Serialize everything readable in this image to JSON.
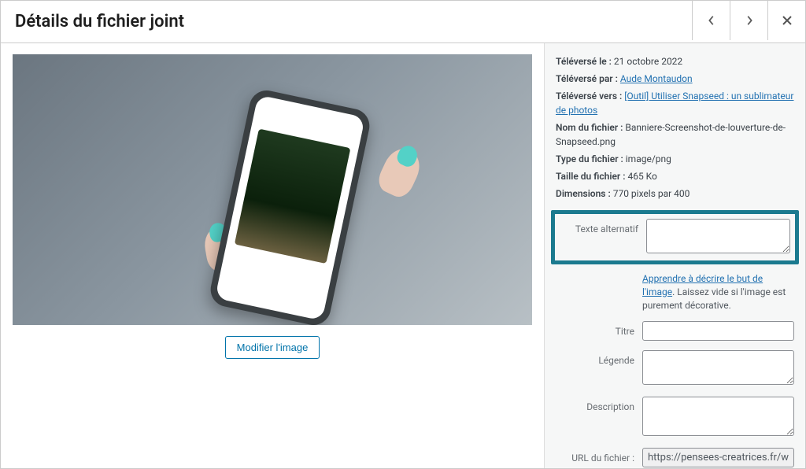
{
  "header": {
    "title": "Détails du fichier joint"
  },
  "preview": {
    "edit_button": "Modifier l'image"
  },
  "meta": {
    "uploaded_on_label": "Téléversé le :",
    "uploaded_on_value": "21 octobre 2022",
    "uploaded_by_label": "Téléversé par :",
    "uploaded_by_value": "Aude Montaudon",
    "uploaded_to_label": "Téléversé vers :",
    "uploaded_to_value": "[Outil] Utiliser Snapseed : un sublimateur de photos",
    "filename_label": "Nom du fichier :",
    "filename_value": "Banniere-Screenshot-de-louverture-de-Snapseed.png",
    "filetype_label": "Type du fichier :",
    "filetype_value": "image/png",
    "filesize_label": "Taille du fichier :",
    "filesize_value": "465 Ko",
    "dimensions_label": "Dimensions :",
    "dimensions_value": "770 pixels par 400"
  },
  "fields": {
    "alt_text_label": "Texte alternatif",
    "alt_text_value": "",
    "alt_text_help_link": "Apprendre à décrire le but de l'image",
    "alt_text_help_suffix": ". Laissez vide si l'image est purement décorative.",
    "title_label": "Titre",
    "title_value": "",
    "caption_label": "Légende",
    "caption_value": "",
    "description_label": "Description",
    "description_value": "",
    "file_url_label": "URL du fichier :",
    "file_url_value": "https://pensees-creatrices.fr/w"
  }
}
